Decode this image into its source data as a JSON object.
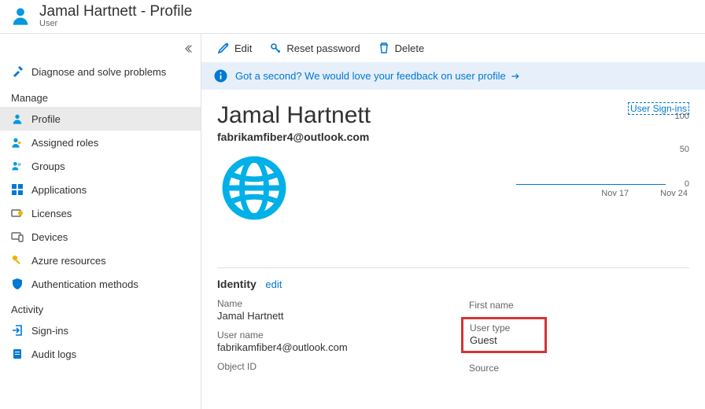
{
  "header": {
    "title": "Jamal Hartnett - Profile",
    "subtitle": "User"
  },
  "sidebar": {
    "diagnose": "Diagnose and solve problems",
    "manage_label": "Manage",
    "activity_label": "Activity",
    "items": {
      "profile": "Profile",
      "assigned_roles": "Assigned roles",
      "groups": "Groups",
      "applications": "Applications",
      "licenses": "Licenses",
      "devices": "Devices",
      "azure_resources": "Azure resources",
      "auth_methods": "Authentication methods",
      "sign_ins": "Sign-ins",
      "audit_logs": "Audit logs"
    }
  },
  "toolbar": {
    "edit": "Edit",
    "reset_password": "Reset password",
    "delete": "Delete"
  },
  "info_bar": {
    "text": "Got a second? We would love your feedback on user profile"
  },
  "profile": {
    "name": "Jamal Hartnett",
    "email": "fabrikamfiber4@outlook.com"
  },
  "identity": {
    "section_title": "Identity",
    "edit_label": "edit",
    "name_label": "Name",
    "name_value": "Jamal Hartnett",
    "username_label": "User name",
    "username_value": "fabrikamfiber4@outlook.com",
    "objectid_label": "Object ID",
    "firstname_label": "First name",
    "usertype_label": "User type",
    "usertype_value": "Guest",
    "source_label": "Source"
  },
  "chart_data": {
    "type": "line",
    "title": "User Sign-ins",
    "ylim": [
      0,
      100
    ],
    "yticks": [
      0,
      50,
      100
    ],
    "categories": [
      "Nov 17",
      "Nov 24"
    ],
    "series": [
      {
        "name": "Sign-ins",
        "values": [
          0,
          0
        ]
      }
    ]
  }
}
